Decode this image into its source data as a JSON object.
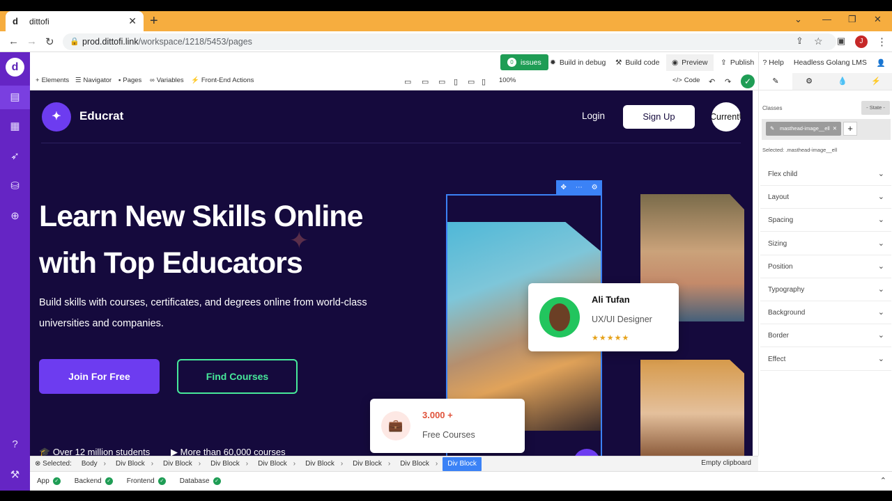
{
  "browser": {
    "tab_title": "dittofi",
    "tab_favicon": "d",
    "url_host": "prod.dittofi.link",
    "url_path": "/workspace/1218/5453/pages",
    "profile_initial": "J"
  },
  "toolbar": {
    "issues_count": "0",
    "issues_label": "issues",
    "build_debug": "Build in debug",
    "build_code": "Build code",
    "preview": "Preview",
    "publish": "Publish",
    "help": "Help",
    "project": "Headless Golang LMS"
  },
  "tools": {
    "elements": "Elements",
    "navigator": "Navigator",
    "pages": "Pages",
    "variables": "Variables",
    "actions": "Front-End Actions",
    "zoom": "100%",
    "code": "Code"
  },
  "right_panel": {
    "classes_label": "Classes",
    "state_label": "- State -",
    "class_chip": "masthead-image__ell",
    "selected_text": "Selected: .masthead-image__ell",
    "sections": [
      "Flex child",
      "Layout",
      "Spacing",
      "Sizing",
      "Position",
      "Typography",
      "Background",
      "Border",
      "Effect"
    ]
  },
  "site": {
    "brand": "Educrat",
    "login": "Login",
    "signup": "Sign Up",
    "user_button": "CurrentUser",
    "headline_line1": "Learn New Skills Online",
    "headline_line2": "with Top Educators",
    "subtitle": "Build skills with courses, certificates, and degrees online from world-class universities and companies.",
    "join": "Join For Free",
    "find": "Find Courses",
    "stat1": "Over 12 million students",
    "stat2": "More than 60,000 courses",
    "card_name": "Ali Tufan",
    "card_role": "UX/UI Designer",
    "card_rating_stars": 5,
    "courses_number": "3.000 +",
    "courses_label": "Free Courses",
    "colors": {
      "bg": "#150a3d",
      "primary": "#6d3cf0",
      "accent": "#47e99a",
      "orange": "#e0523a"
    }
  },
  "breadcrumb": {
    "selected_label": "Selected:",
    "items": [
      "Body",
      "Div Block",
      "Div Block",
      "Div Block",
      "Div Block",
      "Div Block",
      "Div Block",
      "Div Block",
      "Div Block"
    ],
    "empty_clipboard": "Empty clipboard"
  },
  "statusbar": {
    "items": [
      "App",
      "Backend",
      "Frontend",
      "Database"
    ]
  }
}
